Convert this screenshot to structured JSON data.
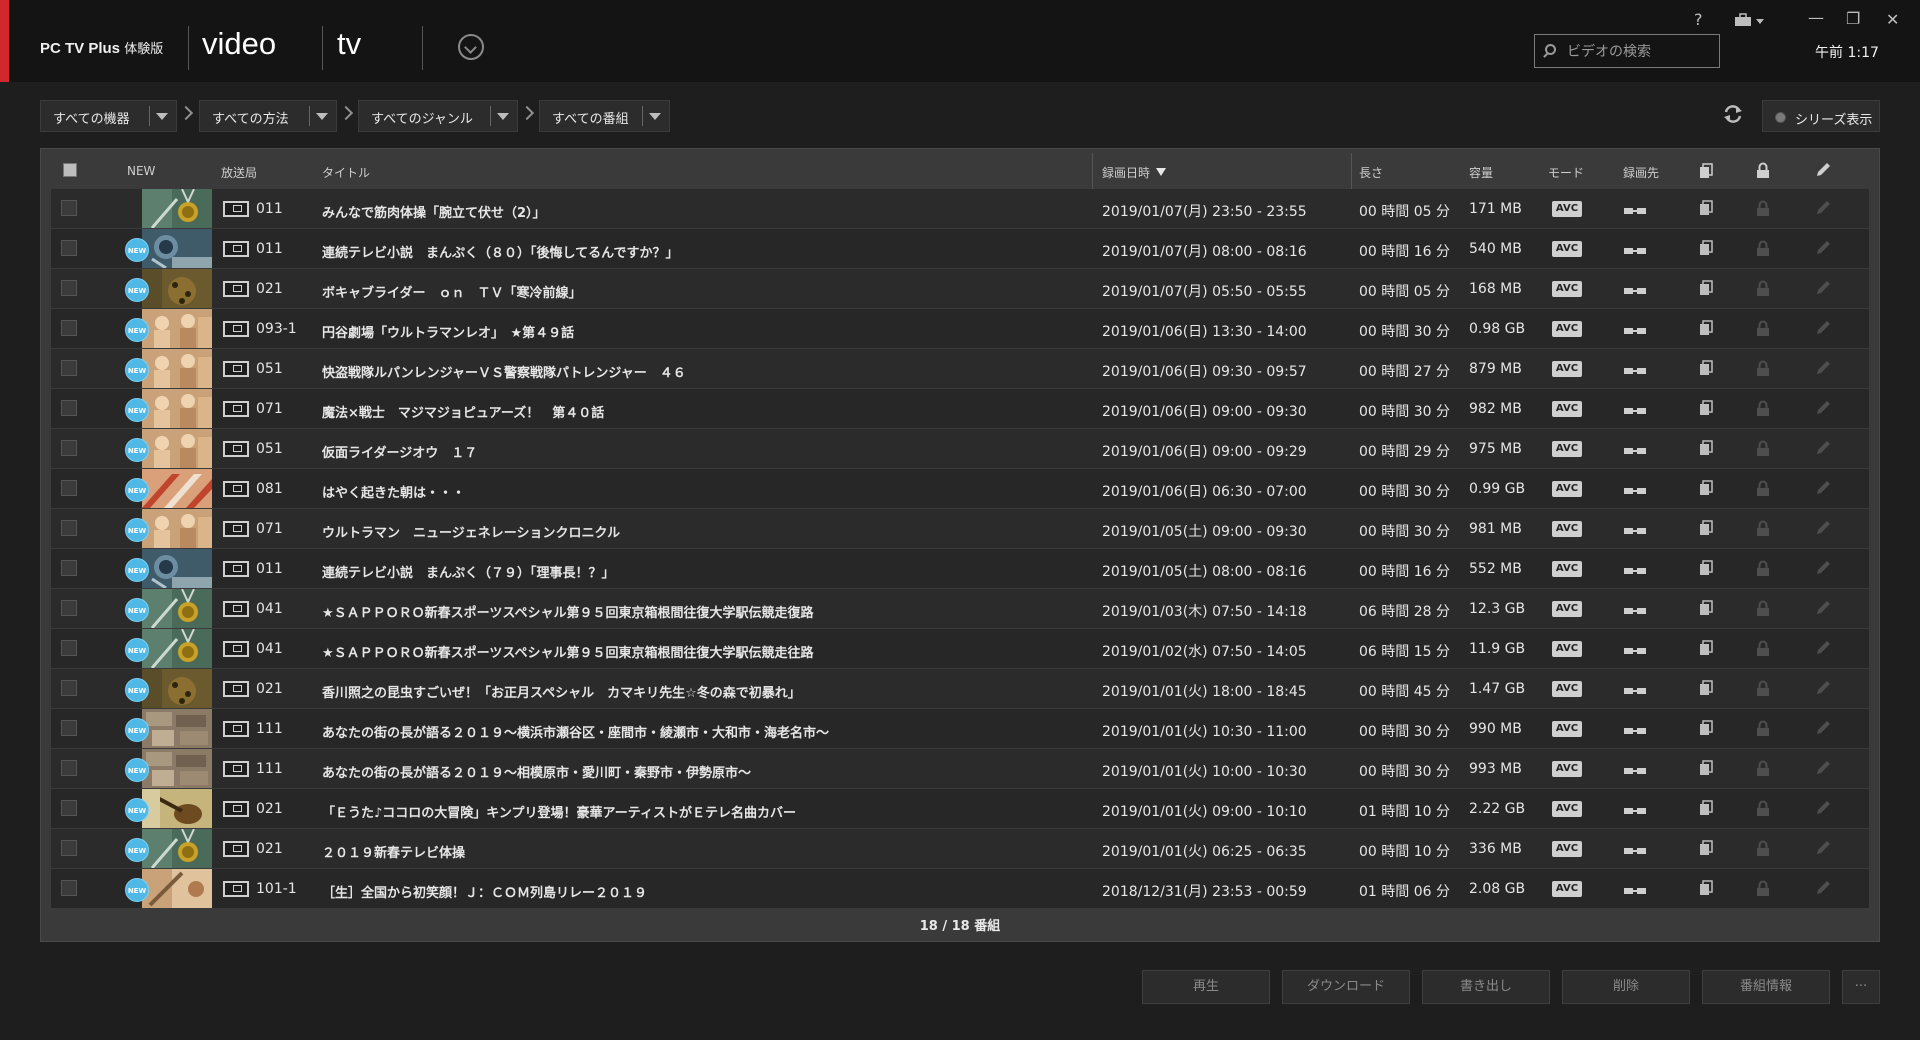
{
  "header": {
    "app_title": "PC TV Plus",
    "app_subtitle": "体験版",
    "tab_video": "video",
    "tab_tv": "tv",
    "search_placeholder": "ビデオの検索",
    "time": "午前 1:17",
    "help": "?",
    "minimize": "—",
    "restore": "❐",
    "close": "✕"
  },
  "filters": {
    "device": "すべての機器",
    "method": "すべての方法",
    "genre": "すべてのジャンル",
    "program": "すべての番組",
    "series_label": "シリーズ表示"
  },
  "table": {
    "headers": {
      "new": "NEW",
      "station": "放送局",
      "title": "タイトル",
      "datetime": "録画日時",
      "length": "長さ",
      "size": "容量",
      "mode": "モード",
      "dest": "録画先"
    },
    "rows": [
      {
        "new": false,
        "new_label": "",
        "thumb": "medal",
        "station": "011",
        "title": "みんなで筋肉体操「腕立て伏せ（2）」",
        "datetime": "2019/01/07(月) 23:50 - 23:55",
        "length": "00 時間 05 分",
        "size": "171 MB",
        "mode": "AVC"
      },
      {
        "new": true,
        "new_label": "NEW",
        "thumb": "globe",
        "station": "011",
        "title": "連続テレビ小説　まんぷく（８０）「後悔してるんですか？」",
        "datetime": "2019/01/07(月) 08:00 - 08:16",
        "length": "00 時間 16 分",
        "size": "540 MB",
        "mode": "AVC"
      },
      {
        "new": true,
        "new_label": "NEW",
        "thumb": "bug",
        "station": "021",
        "title": "ボキャブライダー　ｏｎ　ＴＶ「寒冷前線」",
        "datetime": "2019/01/07(月) 05:50 - 05:55",
        "length": "00 時間 05 分",
        "size": "168 MB",
        "mode": "AVC"
      },
      {
        "new": true,
        "new_label": "NEW",
        "thumb": "people",
        "station": "093-1",
        "title": "円谷劇場「ウルトラマンレオ」　★第４９話",
        "datetime": "2019/01/06(日) 13:30 - 14:00",
        "length": "00 時間 30 分",
        "size": "0.98 GB",
        "mode": "AVC"
      },
      {
        "new": true,
        "new_label": "NEW",
        "thumb": "people",
        "station": "051",
        "title": "快盗戦隊ルパンレンジャーＶＳ警察戦隊パトレンジャー　４６",
        "datetime": "2019/01/06(日) 09:30 - 09:57",
        "length": "00 時間 27 分",
        "size": "879 MB",
        "mode": "AVC"
      },
      {
        "new": true,
        "new_label": "NEW",
        "thumb": "people",
        "station": "071",
        "title": "魔法×戦士　マジマジョピュアーズ！　第４０話",
        "datetime": "2019/01/06(日) 09:00 - 09:30",
        "length": "00 時間 30 分",
        "size": "982 MB",
        "mode": "AVC"
      },
      {
        "new": true,
        "new_label": "NEW",
        "thumb": "people",
        "station": "051",
        "title": "仮面ライダージオウ　１７",
        "datetime": "2019/01/06(日) 09:00 - 09:29",
        "length": "00 時間 29 分",
        "size": "975 MB",
        "mode": "AVC"
      },
      {
        "new": true,
        "new_label": "NEW",
        "thumb": "stripes",
        "station": "081",
        "title": "はやく起きた朝は・・・",
        "datetime": "2019/01/06(日) 06:30 - 07:00",
        "length": "00 時間 30 分",
        "size": "0.99 GB",
        "mode": "AVC"
      },
      {
        "new": true,
        "new_label": "NEW",
        "thumb": "people",
        "station": "071",
        "title": "ウルトラマン　ニュージェネレーションクロニクル",
        "datetime": "2019/01/05(土) 09:00 - 09:30",
        "length": "00 時間 30 分",
        "size": "981 MB",
        "mode": "AVC"
      },
      {
        "new": true,
        "new_label": "NEW",
        "thumb": "globe",
        "station": "011",
        "title": "連続テレビ小説　まんぷく（７９）「理事長！？」",
        "datetime": "2019/01/05(土) 08:00 - 08:16",
        "length": "00 時間 16 分",
        "size": "552 MB",
        "mode": "AVC"
      },
      {
        "new": true,
        "new_label": "NEW",
        "thumb": "medal",
        "station": "041",
        "title": "★ＳＡＰＰＯＲＯ新春スポーツスペシャル第９５回東京箱根間往復大学駅伝競走復路",
        "datetime": "2019/01/03(木) 07:50 - 14:18",
        "length": "06 時間 28 分",
        "size": "12.3 GB",
        "mode": "AVC"
      },
      {
        "new": true,
        "new_label": "NEW",
        "thumb": "medal",
        "station": "041",
        "title": "★ＳＡＰＰＯＲＯ新春スポーツスペシャル第９５回東京箱根間往復大学駅伝競走往路",
        "datetime": "2019/01/02(水) 07:50 - 14:05",
        "length": "06 時間 15 分",
        "size": "11.9 GB",
        "mode": "AVC"
      },
      {
        "new": true,
        "new_label": "NEW",
        "thumb": "bug",
        "station": "021",
        "title": "香川照之の昆虫すごいぜ！「お正月スペシャル　カマキリ先生☆冬の森で初暴れ」",
        "datetime": "2019/01/01(火) 18:00 - 18:45",
        "length": "00 時間 45 分",
        "size": "1.47 GB",
        "mode": "AVC"
      },
      {
        "new": true,
        "new_label": "NEW",
        "thumb": "map",
        "station": "111",
        "title": "あなたの街の長が語る２０１９～横浜市瀬谷区・座間市・綾瀬市・大和市・海老名市～",
        "datetime": "2019/01/01(火) 10:30 - 11:00",
        "length": "00 時間 30 分",
        "size": "990 MB",
        "mode": "AVC"
      },
      {
        "new": true,
        "new_label": "NEW",
        "thumb": "map",
        "station": "111",
        "title": "あなたの街の長が語る２０１９～相模原市・愛川町・秦野市・伊勢原市～",
        "datetime": "2019/01/01(火) 10:00 - 10:30",
        "length": "00 時間 30 分",
        "size": "993 MB",
        "mode": "AVC"
      },
      {
        "new": true,
        "new_label": "NEW",
        "thumb": "guitar",
        "station": "021",
        "title": "「Ｅうた♪ココロの大冒険」キンプリ登場！豪華アーティストがＥテレ名曲カバー",
        "datetime": "2019/01/01(火) 09:00 - 10:10",
        "length": "01 時間 10 分",
        "size": "2.22 GB",
        "mode": "AVC"
      },
      {
        "new": true,
        "new_label": "NEW",
        "thumb": "medal",
        "station": "021",
        "title": "２０１９新春テレビ体操",
        "datetime": "2019/01/01(火) 06:25 - 06:35",
        "length": "00 時間 10 分",
        "size": "336 MB",
        "mode": "AVC"
      },
      {
        "new": true,
        "new_label": "NEW",
        "thumb": "pen",
        "station": "101-1",
        "title": "［生］全国から初笑顔！Ｊ：ＣＯＭ列島リレー２０１９",
        "datetime": "2018/12/31(月) 23:53 - 00:59",
        "length": "01 時間 06 分",
        "size": "2.08 GB",
        "mode": "AVC"
      }
    ],
    "footer": "18 / 18 番組"
  },
  "actions": {
    "play": "再生",
    "download": "ダウンロード",
    "export": "書き出し",
    "delete": "削除",
    "info": "番組情報",
    "more": "···"
  },
  "colors": {
    "accent_red": "#d1282e",
    "new_badge": "#4fb8e6",
    "background": "#1e1e1e"
  }
}
